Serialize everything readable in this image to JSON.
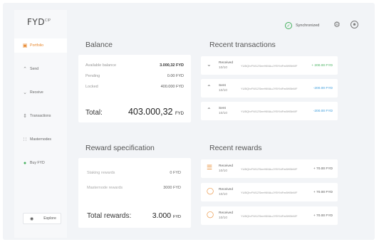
{
  "app": {
    "logo": "FYD",
    "logo_mark": "CIP"
  },
  "nav": {
    "items": [
      {
        "label": "Portfolio",
        "icon": "wallet-icon"
      },
      {
        "label": "Send",
        "icon": "send-icon"
      },
      {
        "label": "Receive",
        "icon": "receive-icon"
      },
      {
        "label": "Transactions",
        "icon": "transactions-icon"
      },
      {
        "label": "Masternodes",
        "icon": "masternodes-icon"
      },
      {
        "label": "Buy FYD",
        "icon": "buy-icon"
      }
    ],
    "explore_label": "Explore"
  },
  "header": {
    "sync_status": "Synchronized"
  },
  "balance": {
    "title": "Balance",
    "rows": [
      {
        "label": "Available balance",
        "value": "3.000,32 FYD"
      },
      {
        "label": "Pending",
        "value": "0.00 FYD"
      },
      {
        "label": "Locked",
        "value": "400.000 FYD"
      }
    ],
    "total_label": "Total:",
    "total_value": "403.000,32",
    "total_unit": "FYD"
  },
  "rewards_spec": {
    "title": "Reward specification",
    "rows": [
      {
        "label": "Staking rewards",
        "value": "0 FYD"
      },
      {
        "label": "Masternode rewards",
        "value": "3000 FYD"
      }
    ],
    "total_label": "Total rewards:",
    "total_value": "3.000",
    "total_unit": "FYD"
  },
  "recent_transactions": {
    "title": "Recent transactions",
    "items": [
      {
        "type": "Received",
        "date": "10/10",
        "address": "YUBQhrFW1ZSeeHiMAuJYBYbiFm8HBbWF",
        "amount": "+ 200.00 FYD",
        "kind": "pos"
      },
      {
        "type": "Sent",
        "date": "10/10",
        "address": "YUBQhrFW1ZSeeHiMAuJYBYbiFm8HBbWF",
        "amount": "-200.00 FYD",
        "kind": "neg"
      },
      {
        "type": "Sent",
        "date": "10/10",
        "address": "YUBQhrFW1ZSeeHiMAuJYBYbiFm8HBbWF",
        "amount": "-200.00 FYD",
        "kind": "neg"
      }
    ]
  },
  "recent_rewards": {
    "title": "Recent rewards",
    "items": [
      {
        "type": "Received",
        "date": "10/10",
        "address": "YUBQhrFW1ZSeeHiMAuJYBYbiFm8HBbWF",
        "amount": "+ 70.00 FYD"
      },
      {
        "type": "Received",
        "date": "10/10",
        "address": "YUBQhrFW1ZSeeHiMAuJYBYbiFm8HBbWF",
        "amount": "+ 70.00 FYD"
      },
      {
        "type": "Received",
        "date": "10/10",
        "address": "YUBQhrFW1ZSeeHiMAuJYBYbiFm8HBbWF",
        "amount": "+ 70.00 FYD"
      }
    ]
  },
  "colors": {
    "accent": "#e8892f",
    "positive": "#43b05c",
    "negative": "#3a9bdc"
  }
}
